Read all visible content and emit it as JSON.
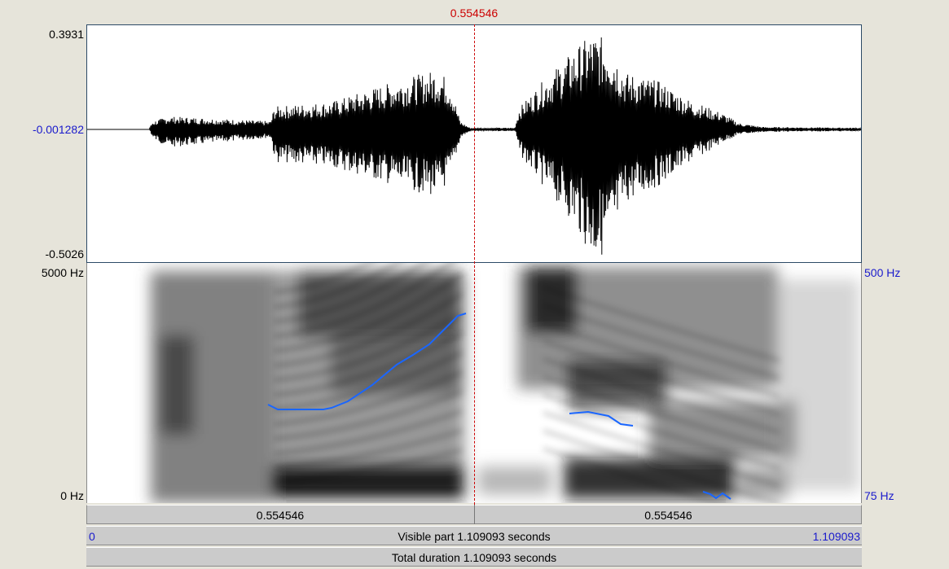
{
  "cursor": {
    "time_label": "0.554546"
  },
  "waveform": {
    "max_label": "0.3931",
    "zero_label": "-0.001282",
    "min_label": "-0.5026"
  },
  "spectrogram": {
    "freq_top_label": "5000 Hz",
    "freq_bottom_label": "0 Hz",
    "pitch_top_label": "500 Hz",
    "pitch_bottom_label": "75 Hz"
  },
  "selection": {
    "left_label": "0.554546",
    "right_label": "0.554546"
  },
  "visible": {
    "start_label": "0",
    "label": "Visible part 1.109093 seconds",
    "end_label": "1.109093"
  },
  "total": {
    "label": "Total duration 1.109093 seconds"
  },
  "colors": {
    "cursor": "#cc0000",
    "pitch": "#1a66ff",
    "axis_blue": "#1a1acc"
  }
}
